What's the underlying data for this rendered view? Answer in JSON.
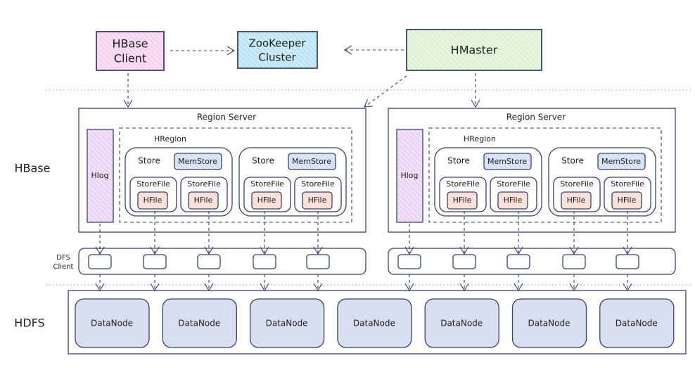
{
  "top": {
    "client": "HBase Client",
    "client_lines": [
      "HBase",
      "Client"
    ],
    "zookeeper_lines": [
      "ZooKeeper",
      "Cluster"
    ],
    "hmaster": "HMaster"
  },
  "layers": {
    "hbase": "HBase",
    "hdfs": "HDFS",
    "dfs_client_lines": [
      "DFS",
      "Client"
    ]
  },
  "region_servers": [
    {
      "title": "Region Server",
      "hlog": "Hlog",
      "hregion": "HRegion",
      "stores": [
        {
          "label": "Store",
          "memstore": "MemStore",
          "storefiles": [
            {
              "label": "StoreFile",
              "hfile": "HFile"
            },
            {
              "label": "StoreFile",
              "hfile": "HFile"
            }
          ]
        },
        {
          "label": "Store",
          "memstore": "MemStore",
          "storefiles": [
            {
              "label": "StoreFile",
              "hfile": "HFile"
            },
            {
              "label": "StoreFile",
              "hfile": "HFile"
            }
          ]
        }
      ]
    },
    {
      "title": "Region Server",
      "hlog": "Hlog",
      "hregion": "HRegion",
      "stores": [
        {
          "label": "Store",
          "memstore": "MemStore",
          "storefiles": [
            {
              "label": "StoreFile",
              "hfile": "HFile"
            },
            {
              "label": "StoreFile",
              "hfile": "HFile"
            }
          ]
        },
        {
          "label": "Store",
          "memstore": "MemStore",
          "storefiles": [
            {
              "label": "StoreFile",
              "hfile": "HFile"
            },
            {
              "label": "StoreFile",
              "hfile": "HFile"
            }
          ]
        }
      ]
    }
  ],
  "datanodes": [
    "DataNode",
    "DataNode",
    "DataNode",
    "DataNode",
    "DataNode",
    "DataNode",
    "DataNode"
  ],
  "colors": {
    "stroke": "#3b4266",
    "client": "#f5c2ea",
    "zookeeper": "#a5dcf2",
    "hmaster": "#d5ecc8",
    "hlog": "#e3c6f2",
    "memstore": "#c3d3f5",
    "hfile": "#f7cfc4",
    "datanode": "#dadff0",
    "separator": "#9aa4d6"
  }
}
